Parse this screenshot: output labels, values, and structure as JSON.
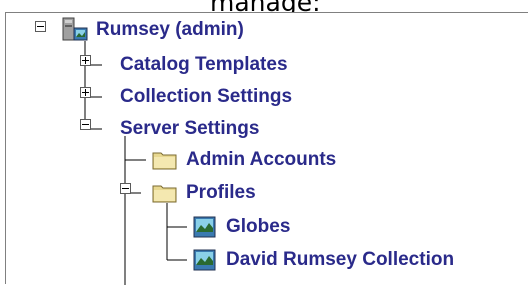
{
  "caption": "manage:",
  "tree": {
    "root": {
      "label": "Rumsey (admin)",
      "icon": "server-icon",
      "expanded": true
    },
    "catalog_templates": {
      "label": "Catalog Templates",
      "expanded": false
    },
    "collection_settings": {
      "label": "Collection Settings",
      "expanded": false
    },
    "server_settings": {
      "label": "Server Settings",
      "expanded": true
    },
    "admin_accounts": {
      "label": "Admin Accounts",
      "icon": "folder-icon"
    },
    "profiles": {
      "label": "Profiles",
      "icon": "folder-icon",
      "expanded": true
    },
    "globes": {
      "label": "Globes",
      "icon": "image-document-icon"
    },
    "david_rumsey": {
      "label": "David Rumsey Collection",
      "icon": "image-document-icon"
    }
  },
  "colors": {
    "label": "#2a2a8a",
    "folder": "#e8d890",
    "line": "#000000"
  }
}
